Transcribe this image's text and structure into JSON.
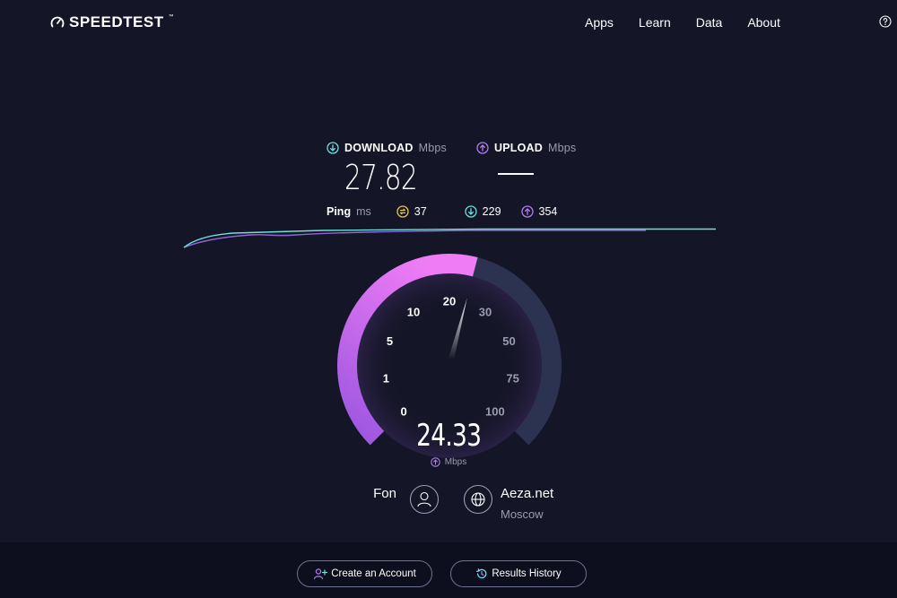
{
  "header": {
    "brand": "SPEEDTEST",
    "nav": [
      "Apps",
      "Learn",
      "Data",
      "About"
    ]
  },
  "download": {
    "label": "DOWNLOAD",
    "unit": "Mbps",
    "value": "27.82"
  },
  "upload": {
    "label": "UPLOAD",
    "unit": "Mbps"
  },
  "ping": {
    "label": "Ping",
    "unit": "ms",
    "idle": "37",
    "download": "229",
    "upload": "354"
  },
  "gauge": {
    "value": "24.33",
    "unit": "Mbps",
    "ticks": [
      "0",
      "1",
      "5",
      "10",
      "20",
      "30",
      "50",
      "75",
      "100"
    ],
    "current_value": 24.33,
    "active_color": "#f07cf5",
    "active_color_end": "#9a55e0",
    "track_color": "#2b3350"
  },
  "provider": {
    "name": "Fon"
  },
  "server": {
    "name": "Aeza.net",
    "location": "Moscow"
  },
  "footer": {
    "create_account": "Create an Account",
    "results_history": "Results History"
  },
  "colors": {
    "download": "#6be0dd",
    "upload": "#b07ef2",
    "ping": "#e6c84a",
    "background": "#141526"
  }
}
